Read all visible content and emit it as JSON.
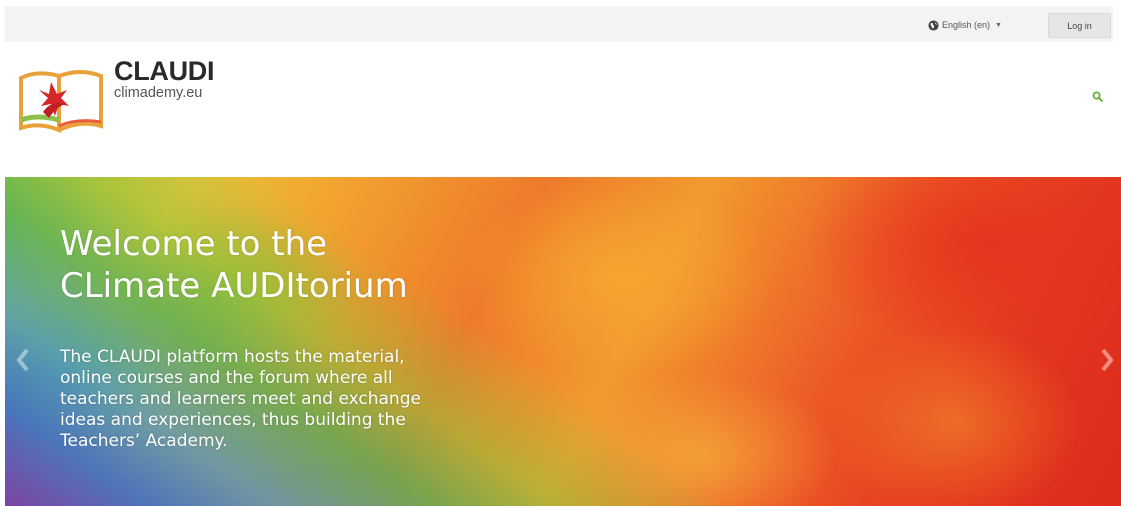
{
  "topbar": {
    "language_label": "English (en)",
    "login_label": "Log in"
  },
  "header": {
    "site_name": "CLAUDI",
    "site_url": "climademy.eu",
    "search_icon": "search-icon"
  },
  "hero": {
    "title_lines": [
      "Welcome to the",
      "CLimate AUDItorium"
    ],
    "text_lines": [
      "The CLAUDI platform hosts the material,",
      "online courses and the forum where all",
      "teachers and learners meet and exchange",
      "ideas and experiences, thus building the",
      "Teachers’ Academy."
    ],
    "prev_icon": "chevron-left-icon",
    "next_icon": "chevron-right-icon"
  },
  "colors": {
    "accent_green": "#6ab23c",
    "topbar_bg": "#f3f3f3"
  }
}
